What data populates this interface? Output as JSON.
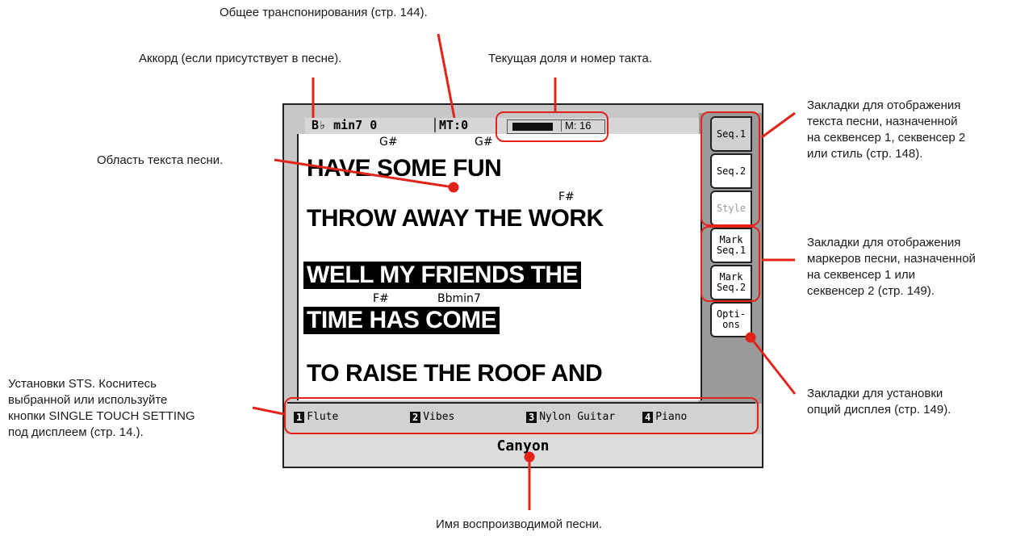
{
  "callouts": {
    "transpose": "Общее транспонирования (стр. 144).",
    "chord": "Аккорд (если присутствует в песне).",
    "beat": "Текущая доля и номер такта.",
    "lyrics_area": "Область текста песни.",
    "tabs_lyrics": [
      "Закладки для отображения",
      "текста песни, назначенной",
      "на секвенсер 1, секвенсер 2",
      "или стиль (стр. 148)."
    ],
    "tabs_markers": [
      "Закладки для отображения",
      "маркеров песни, назначенной",
      "на секвенсер 1 или",
      "секвенсер 2 (стр. 149)."
    ],
    "sts": [
      "Установки STS. Коснитесь",
      "выбранной или используйте",
      "кнопки SINGLE TOUCH SETTING",
      "под дисплеем (стр. 14.)."
    ],
    "options": [
      "Закладки для установки",
      "опций дисплея (стр. 149)."
    ],
    "song_name_caption": "Имя воспроизводимой песни."
  },
  "display": {
    "chord_readout": "B♭ min7 0",
    "transpose_readout": "MT:0",
    "measure_readout": "M: 16",
    "lyrics": [
      {
        "text": "HAVE SOME FUN",
        "highlight": false,
        "chords": [
          "G#",
          "G#"
        ]
      },
      {
        "text": "THROW AWAY THE WORK",
        "highlight": false,
        "chords": [
          "F#"
        ]
      },
      {
        "text": "WELL MY FRIENDS THE",
        "highlight": true,
        "chords": []
      },
      {
        "text": "TIME HAS COME",
        "highlight": true,
        "chords": [
          "F#",
          "Bbmin7"
        ]
      },
      {
        "text": "TO RAISE THE ROOF AND",
        "highlight": false,
        "chords": []
      }
    ],
    "tabs": {
      "seq1": "Seq.1",
      "seq2": "Seq.2",
      "style": "Style",
      "mark_seq1": [
        "Mark",
        "Seq.1"
      ],
      "mark_seq2": [
        "Mark",
        "Seq.2"
      ],
      "options": [
        "Opti-",
        "ons"
      ]
    },
    "sts": [
      {
        "num": "1",
        "label": "Flute"
      },
      {
        "num": "2",
        "label": "Vibes"
      },
      {
        "num": "3",
        "label": "Nylon Guitar"
      },
      {
        "num": "4",
        "label": "Piano"
      }
    ],
    "song_name": "Canyon"
  },
  "colors": {
    "callout_red": "#e2231a",
    "highlight_bg": "#000000"
  }
}
